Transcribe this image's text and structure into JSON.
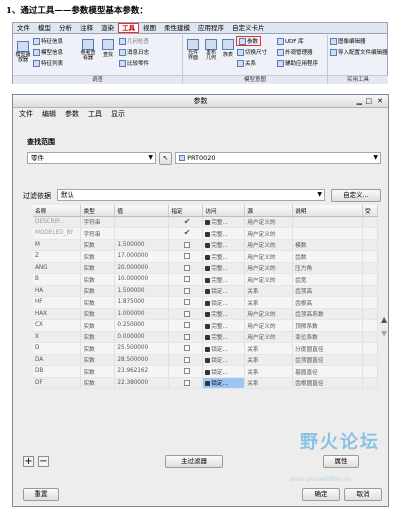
{
  "heading": "1、通过工具——参数模型基本参数：",
  "ribbon": {
    "tabs": [
      "文件",
      "模型",
      "分析",
      "注释",
      "渲染",
      "工具",
      "视图",
      "柔性建模",
      "应用程序",
      "自定义卡片"
    ],
    "active_tab": "工具",
    "groups": [
      {
        "label": "调查",
        "items": [
          "特征信息",
          "模型信息",
          "特征列表",
          "模型播放器",
          "参考查看器",
          "查找",
          "几何检查",
          "消息日志",
          "比较零件"
        ]
      },
      {
        "label": "模型意图",
        "items": [
          "元件界面",
          "发布几何",
          "族表",
          "参数",
          "切换尺寸",
          "关系",
          "UDF 库",
          "外观管理器",
          "辅助应用程序"
        ]
      },
      {
        "label": "实用工具",
        "items": [
          "图像编辑器",
          "导入配置文件编辑器"
        ]
      }
    ]
  },
  "dialog": {
    "title": "参数",
    "menu": [
      "文件",
      "编辑",
      "参数",
      "工具",
      "显示"
    ],
    "scope_label": "查找范围",
    "scope_value": "零件",
    "part_value": "PRT0020",
    "filter_label": "过滤依据",
    "filter_value": "默认",
    "customize_label": "自定义...",
    "columns": [
      "名称",
      "类型",
      "值",
      "指定",
      "访问",
      "源",
      "说明",
      "受"
    ],
    "rows": [
      {
        "name": "DESCRIP...",
        "type": "字符串",
        "value": "",
        "designated": true,
        "access": "完整...",
        "source": "用户定义的",
        "desc": ""
      },
      {
        "name": "MODELED_BY",
        "type": "字符串",
        "value": "",
        "designated": true,
        "access": "完整...",
        "source": "用户定义的",
        "desc": ""
      },
      {
        "name": "M",
        "type": "实数",
        "value": "1.500000",
        "designated": false,
        "access": "完整...",
        "source": "用户定义的",
        "desc": "模数"
      },
      {
        "name": "Z",
        "type": "实数",
        "value": "17.000000",
        "designated": false,
        "access": "完整...",
        "source": "用户定义的",
        "desc": "齿数"
      },
      {
        "name": "ANG",
        "type": "实数",
        "value": "20.000000",
        "designated": false,
        "access": "完整...",
        "source": "用户定义的",
        "desc": "压力角"
      },
      {
        "name": "B",
        "type": "实数",
        "value": "10.000000",
        "designated": false,
        "access": "完整...",
        "source": "用户定义的",
        "desc": "齿宽"
      },
      {
        "name": "HA",
        "type": "实数",
        "value": "1.500000",
        "designated": false,
        "access": "锁定...",
        "source": "关系",
        "desc": "齿顶高"
      },
      {
        "name": "HF",
        "type": "实数",
        "value": "1.875000",
        "designated": false,
        "access": "锁定...",
        "source": "关系",
        "desc": "齿根高"
      },
      {
        "name": "HAX",
        "type": "实数",
        "value": "1.000000",
        "designated": false,
        "access": "完整...",
        "source": "用户定义的",
        "desc": "齿顶高系数"
      },
      {
        "name": "CX",
        "type": "实数",
        "value": "0.250000",
        "designated": false,
        "access": "完整...",
        "source": "用户定义的",
        "desc": "顶隙系数"
      },
      {
        "name": "X",
        "type": "实数",
        "value": "0.000000",
        "designated": false,
        "access": "完整...",
        "source": "用户定义的",
        "desc": "变位系数"
      },
      {
        "name": "D",
        "type": "实数",
        "value": "25.500000",
        "designated": false,
        "access": "锁定...",
        "source": "关系",
        "desc": "分度圆直径"
      },
      {
        "name": "DA",
        "type": "实数",
        "value": "28.500000",
        "designated": false,
        "access": "锁定...",
        "source": "关系",
        "desc": "齿顶圆直径"
      },
      {
        "name": "DB",
        "type": "实数",
        "value": "23.962162",
        "designated": false,
        "access": "锁定...",
        "source": "关系",
        "desc": "基圆直径"
      },
      {
        "name": "DF",
        "type": "实数",
        "value": "22.380000",
        "designated": false,
        "access": "锁定...",
        "source": "关系",
        "desc": "齿根圆直径"
      }
    ],
    "main_filter_label": "主过滤器",
    "properties_label": "属性",
    "reset_label": "重置",
    "ok_label": "确定",
    "cancel_label": "取消"
  },
  "watermark": {
    "text": "野火论坛",
    "url": "www.proewildfire.cn"
  }
}
